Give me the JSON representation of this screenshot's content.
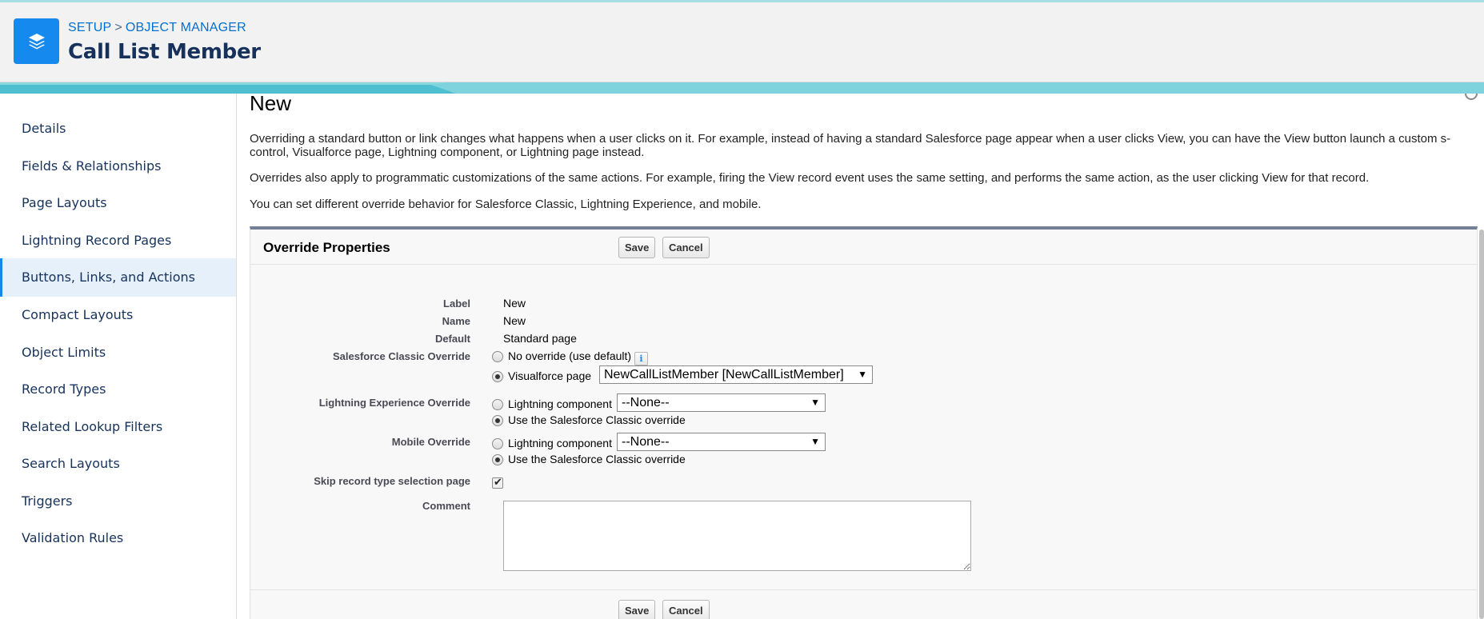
{
  "header": {
    "breadcrumb": [
      "SETUP",
      "OBJECT MANAGER"
    ],
    "breadcrumb_separator": ">",
    "title": "Call List Member",
    "icon": "layers-icon"
  },
  "sidebar": {
    "items": [
      {
        "label": "Details"
      },
      {
        "label": "Fields & Relationships"
      },
      {
        "label": "Page Layouts"
      },
      {
        "label": "Lightning Record Pages"
      },
      {
        "label": "Buttons, Links, and Actions",
        "active": true
      },
      {
        "label": "Compact Layouts"
      },
      {
        "label": "Object Limits"
      },
      {
        "label": "Record Types"
      },
      {
        "label": "Related Lookup Filters"
      },
      {
        "label": "Search Layouts"
      },
      {
        "label": "Triggers"
      },
      {
        "label": "Validation Rules"
      }
    ]
  },
  "main": {
    "title": "New",
    "paragraphs": [
      "Overriding a standard button or link changes what happens when a user clicks on it. For example, instead of having a standard Salesforce page appear when a user clicks View, you can have the View button launch a custom s-control, Visualforce page, Lightning component, or Lightning page instead.",
      "Overrides also apply to programmatic customizations of the same actions. For example, firing the View record event uses the same setting, and performs the same action, as the user clicking View for that record.",
      "You can set different override behavior for Salesforce Classic, Lightning Experience, and mobile."
    ],
    "panel": {
      "title": "Override Properties",
      "save_label": "Save",
      "cancel_label": "Cancel",
      "fields": {
        "label": {
          "label": "Label",
          "value": "New"
        },
        "name": {
          "label": "Name",
          "value": "New"
        },
        "default": {
          "label": "Default",
          "value": "Standard page"
        },
        "classic": {
          "label": "Salesforce Classic Override",
          "opt_none": "No override (use default)",
          "opt_vf": "Visualforce page",
          "vf_value": "NewCallListMember [NewCallListMember]",
          "selected": "vf"
        },
        "lightning": {
          "label": "Lightning Experience Override",
          "opt_component": "Lightning component",
          "component_value": "--None--",
          "opt_classic": "Use the Salesforce Classic override",
          "selected": "classic"
        },
        "mobile": {
          "label": "Mobile Override",
          "opt_component": "Lightning component",
          "component_value": "--None--",
          "opt_classic": "Use the Salesforce Classic override",
          "selected": "classic"
        },
        "skip": {
          "label": "Skip record type selection page",
          "checked": true
        },
        "comment": {
          "label": "Comment",
          "value": ""
        }
      }
    }
  },
  "colors": {
    "brand": "#1589ee",
    "link": "#0070d2",
    "header_bg": "#f3f2f2",
    "active_nav_bg": "#e6f0fa"
  }
}
